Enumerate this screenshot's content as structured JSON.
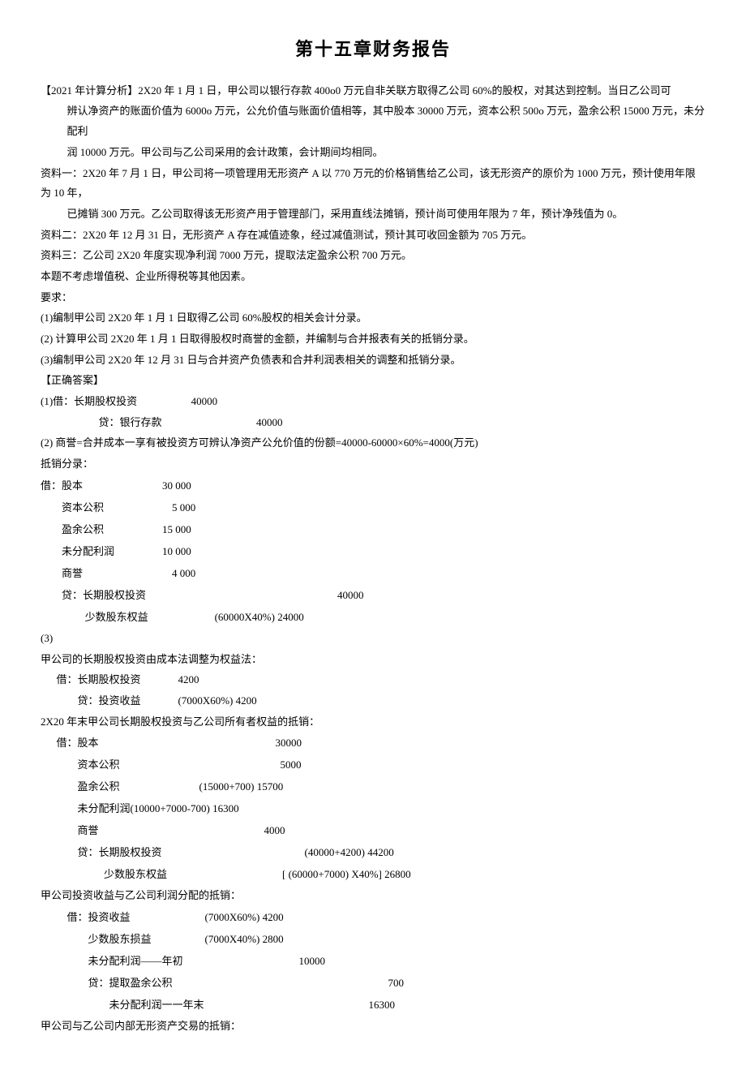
{
  "title": "第十五章财务报告",
  "intro": {
    "p1_a": "【2021 年计算分析】2X20 年 1 月 1 日，甲公司以银行存款 400o0 万元自非关联方取得乙公司 60%的股权，对其达到控制。当日乙公司可",
    "p1_b": "辨认净资产的账面价值为 6000o 万元，公允价值与账面价值相等，其中股本 30000 万元，资本公积 500o 万元，盈余公积 15000 万元，未分配利",
    "p1_c": "润 10000 万元。甲公司与乙公司采用的会计政策，会计期间均相同。",
    "p2_a": "资料一：2X20 年 7 月 1 日，甲公司将一项管理用无形资产 A 以 770 万元的价格销售给乙公司，该无形资产的原价为 1000 万元，预计使用年限为 10 年，",
    "p2_b": "已摊销 300 万元。乙公司取得该无形资产用于管理部门，采用直线法摊销，预计尚可使用年限为 7 年，预计净残值为 0。",
    "p3": "资料二：2X20 年 12 月 31 日，无形资产 A 存在减值迹象，经过减值测试，预计其可收回金额为 705 万元。",
    "p4": "资料三：乙公司 2X20 年度实现净利润 7000 万元，提取法定盈余公积 700 万元。",
    "p5": "本题不考虑增值税、企业所得税等其他因素。",
    "req_label": "要求：",
    "req1": "(1)编制甲公司 2X20 年 1 月 1 日取得乙公司 60%股权的相关会计分录。",
    "req2": "(2) 计算甲公司 2X20 年 1 月 1 日取得股权时商誉的金额，并编制与合并报表有关的抵销分录。",
    "req3": "(3)编制甲公司 2X20 年 12 月 31 日与合并资产负债表和合并利润表相关的调整和抵销分录。"
  },
  "answer_label": "【正确答案】",
  "ans1": {
    "head": "(1)借：长期股权投资",
    "val1": "40000",
    "cr": "贷：银行存款",
    "val2": "40000"
  },
  "ans2": {
    "line": "(2) 商誉=合并成本一享有被投资方可辨认净资产公允价值的份额=40000-60000×60%=4000(万元)",
    "offset_label": "抵销分录：",
    "r1_a": "借：股本",
    "r1_b": "30   000",
    "r2_a": "资本公积",
    "r2_b": "5  000",
    "r3_a": "盈余公积",
    "r3_b": "15   000",
    "r4_a": "未分配利润",
    "r4_b": "10   000",
    "r5_a": "商誉",
    "r5_b": "4  000",
    "r6_a": "贷：长期股权投资",
    "r6_b": "40000",
    "r7_a": "少数股东权益",
    "r7_b": "(60000X40%) 24000"
  },
  "ans3": {
    "head": "(3)",
    "sec_a_label": "甲公司的长期股权投资由成本法调整为权益法：",
    "a1_a": "借：长期股权投资",
    "a1_b": "4200",
    "a2_a": "贷：投资收益",
    "a2_b": "(7000X60%) 4200",
    "sec_b_label": "2X20 年末甲公司长期股权投资与乙公司所有者权益的抵销：",
    "b1_a": "借：股本",
    "b1_b": "30000",
    "b2_a": "资本公积",
    "b2_b": "5000",
    "b3_a": "盈余公积",
    "b3_b": "(15000+700) 15700",
    "b4": "未分配利润(10000+7000-700) 16300",
    "b5_a": "商誉",
    "b5_b": "4000",
    "b6_a": "贷：长期股权投资",
    "b6_b": "(40000+4200) 44200",
    "b7_a": "少数股东权益",
    "b7_b": "[ (60000+7000) X40%] 26800",
    "sec_c_label": "甲公司投资收益与乙公司利润分配的抵销：",
    "c1_a": "借：投资收益",
    "c1_b": "(7000X60%) 4200",
    "c2_a": "少数股东损益",
    "c2_b": "(7000X40%) 2800",
    "c3_a": "未分配利润——年初",
    "c3_b": "10000",
    "c4_a": "贷：提取盈余公积",
    "c4_b": "700",
    "c5_a": "未分配利润一一年末",
    "c5_b": "16300",
    "sec_d_label": "甲公司与乙公司内部无形资产交易的抵销："
  }
}
